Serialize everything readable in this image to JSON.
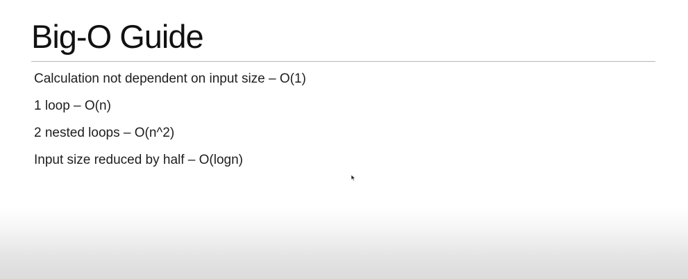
{
  "slide": {
    "title": "Big-O Guide",
    "bullets": [
      "Calculation not dependent on input size – O(1)",
      "1 loop – O(n)",
      "2 nested loops – O(n^2)",
      "Input size reduced by half – O(logn)"
    ]
  },
  "cursor": {
    "icon": "mouse-pointer-icon"
  },
  "colors": {
    "background": "#ffffff",
    "text": "#1d1d1d",
    "divider": "#b5b5b5",
    "bottom_fade": "#dcdcdc"
  }
}
